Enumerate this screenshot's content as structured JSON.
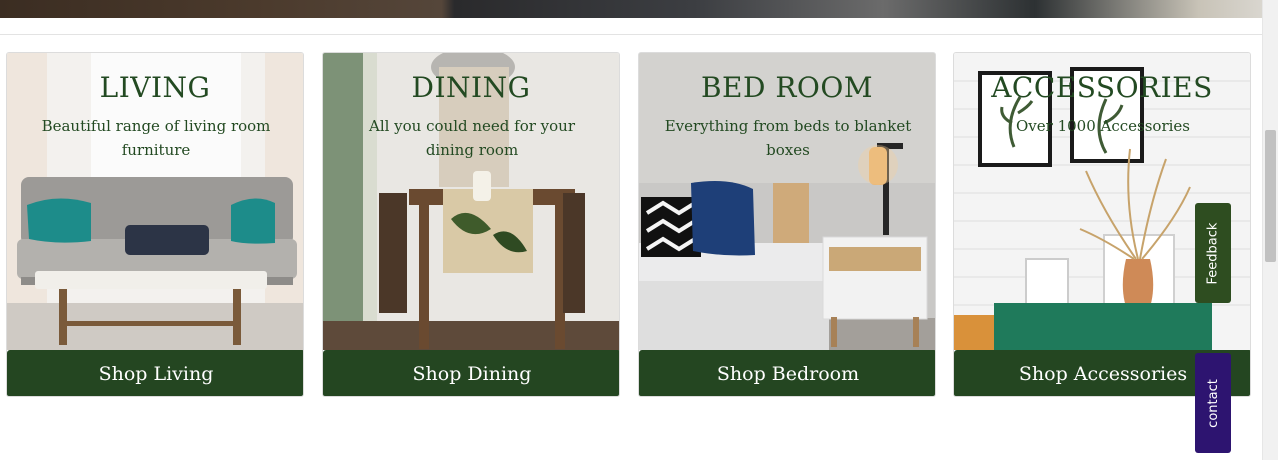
{
  "categories": [
    {
      "title": "LIVING",
      "description": "Beautiful range of living room furniture",
      "button_label": "Shop Living"
    },
    {
      "title": "DINING",
      "description": "All you could need for your dining room",
      "button_label": "Shop Dining"
    },
    {
      "title": "BED ROOM",
      "description": "Everything from beds to blanket boxes",
      "button_label": "Shop Bedroom"
    },
    {
      "title": "ACCESSORIES",
      "description": "Over 1000 Accessories",
      "button_label": "Shop Accessories"
    }
  ],
  "side_tabs": {
    "feedback_label": "Feedback",
    "contact_label": "contact"
  },
  "colors": {
    "brand_green": "#244621",
    "title_green": "#234a22",
    "contact_purple": "#2d1470"
  }
}
